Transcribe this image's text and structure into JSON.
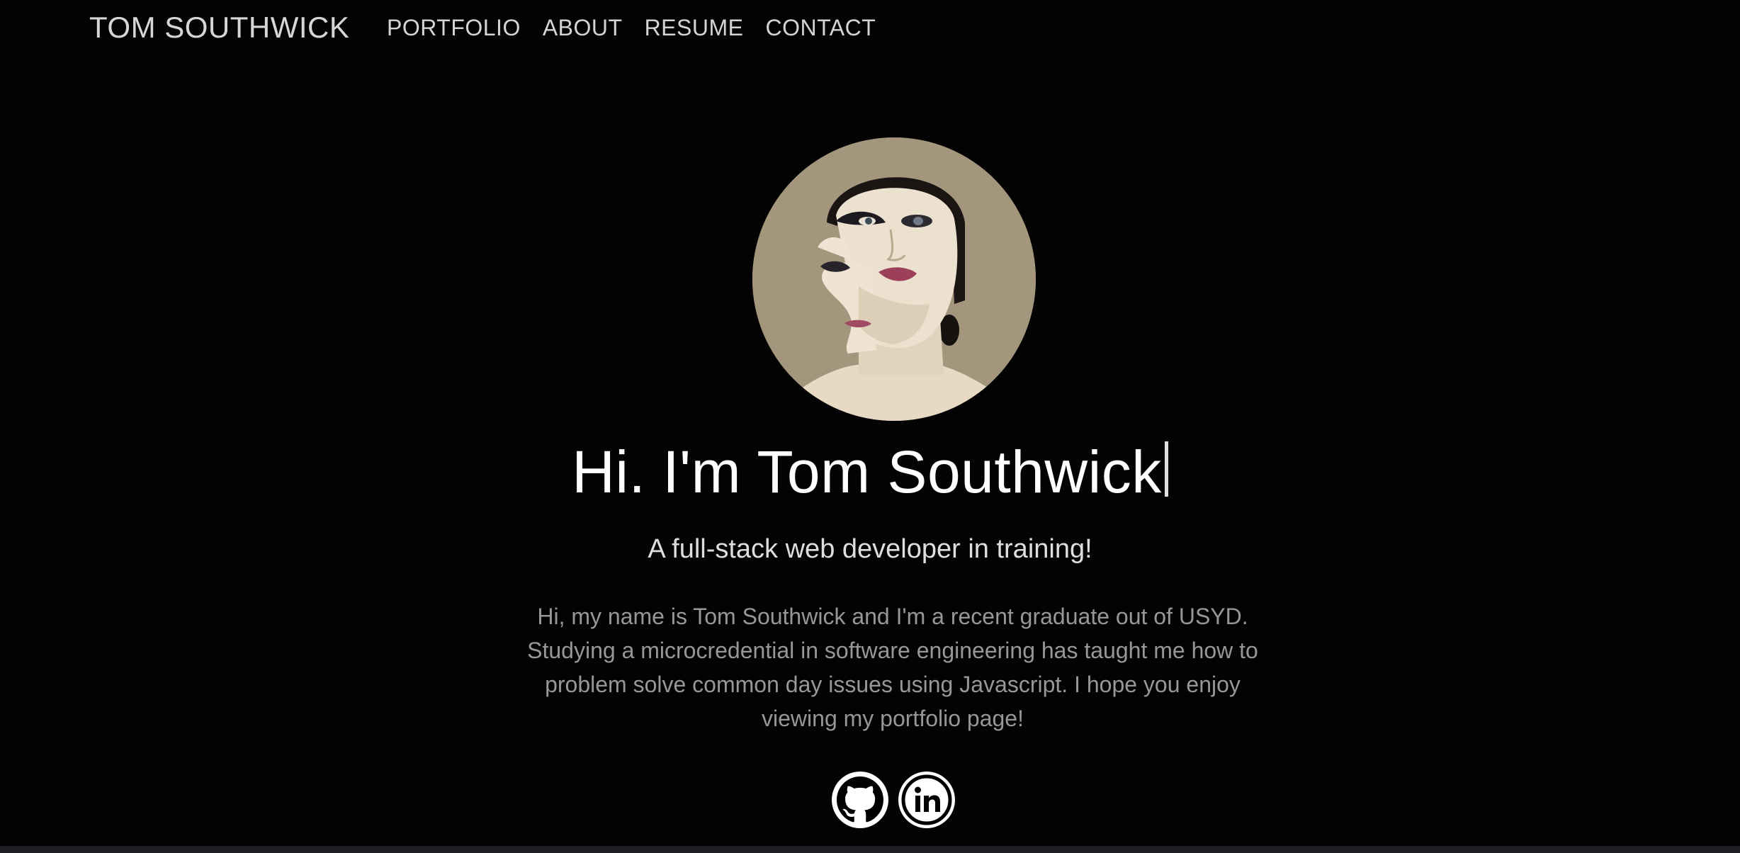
{
  "nav": {
    "brand": "TOM SOUTHWICK",
    "links": [
      {
        "label": "PORTFOLIO"
      },
      {
        "label": "ABOUT"
      },
      {
        "label": "RESUME"
      },
      {
        "label": "CONTACT"
      }
    ]
  },
  "hero": {
    "title": "Hi. I'm Tom Southwick",
    "subtitle": "A full-stack web developer in training!",
    "bio": "Hi, my name is Tom Southwick and I'm a recent graduate out of USYD. Studying a microcredential in software engineering has taught me how to problem solve common day issues using Javascript. I hope you enjoy viewing my portfolio page!"
  },
  "socials": [
    {
      "icon": "github-icon"
    },
    {
      "icon": "linkedin-icon"
    }
  ],
  "colors": {
    "background": "#030303",
    "title": "#ffffff",
    "subtitle": "#dedede",
    "bio": "#979797",
    "nav": "#d4d4d4"
  }
}
